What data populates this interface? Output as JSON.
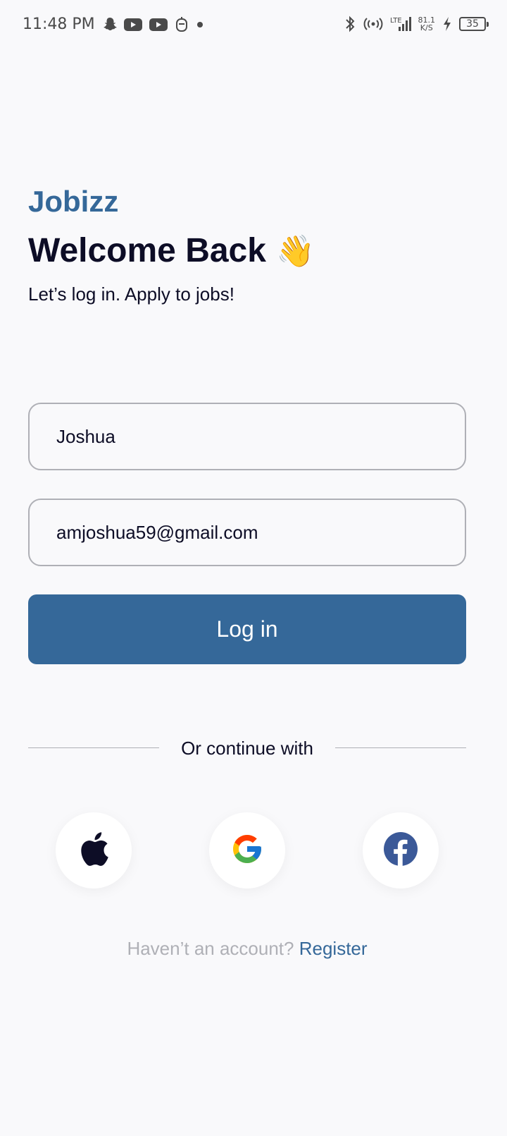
{
  "status_bar": {
    "time": "11:48 PM",
    "net_speed_value": "81.1",
    "net_speed_unit": "K/S",
    "battery": "35",
    "network_type": "LTE"
  },
  "header": {
    "brand": "Jobizz",
    "title": "Welcome Back",
    "emoji": "👋",
    "subtitle": "Let’s log in. Apply to jobs!"
  },
  "form": {
    "name_value": "Joshua",
    "email_value": "amjoshua59@gmail.com",
    "login_label": "Log in"
  },
  "divider_text": "Or continue with",
  "social": {
    "apple_icon": "apple-icon",
    "google_icon": "google-icon",
    "facebook_icon": "facebook-icon"
  },
  "register": {
    "prompt": "Haven’t an account?",
    "link": "Register"
  },
  "colors": {
    "primary": "#356899",
    "text": "#0d0d26",
    "muted": "#afb0b6",
    "background": "#f9f9fb"
  }
}
